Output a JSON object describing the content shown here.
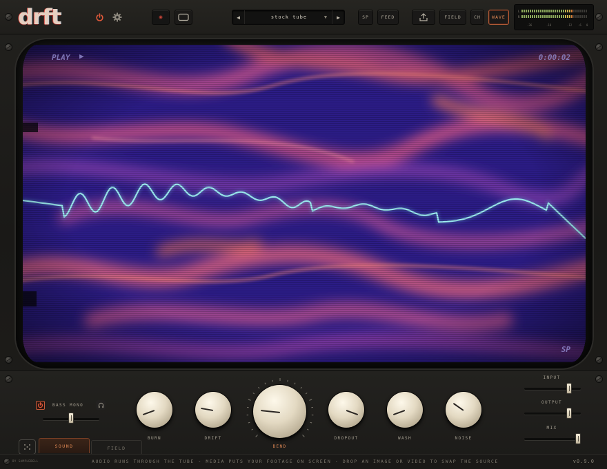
{
  "app": {
    "logo": "drft",
    "version": "v0.9.0",
    "by_line": "BY SAMPLEBELL"
  },
  "header": {
    "preset_name": "stock tube",
    "buttons": {
      "sp": "SP",
      "feed": "FEED",
      "field": "FIELD",
      "ch": "CH",
      "wave": "WAVE"
    },
    "active_view": "WAVE",
    "meter": {
      "l_label": "L",
      "r_label": "R",
      "scale": [
        "-36",
        "-18",
        "-12",
        "-6",
        "0"
      ]
    }
  },
  "screen": {
    "osd_play": "PLAY",
    "osd_time": "0:00:02",
    "osd_mode": "SP"
  },
  "controls": {
    "bass_mono_label": "BASS MONO",
    "bass_mono_enabled": true,
    "bass_mono_level": 0.5,
    "knobs": [
      {
        "id": "burn",
        "label": "BURN"
      },
      {
        "id": "drift",
        "label": "DRIFT"
      },
      {
        "id": "bend",
        "label": "BEND"
      },
      {
        "id": "dropout",
        "label": "DROPOUT"
      },
      {
        "id": "wash",
        "label": "WASH"
      },
      {
        "id": "noise",
        "label": "NOISE"
      }
    ],
    "input_label": "INPUT",
    "output_label": "OUTPUT",
    "mix_label": "MIX",
    "input_level": 0.82,
    "output_level": 0.82,
    "mix_level": 1.0
  },
  "tabs": {
    "sound": "SOUND",
    "field": "FIELD",
    "active": "SOUND"
  },
  "footer": {
    "tagline": "AUDIO RUNS THROUGH THE TUBE  -  MEDIA PUTS YOUR FOOTAGE ON SCREEN  -  DROP AN IMAGE OR VIDEO TO SWAP THE SOURCE"
  },
  "colors": {
    "accent": "#e38a55",
    "power": "#e0593a",
    "screen_base": "#2e1d8c",
    "trace": "#9fe6ee"
  }
}
